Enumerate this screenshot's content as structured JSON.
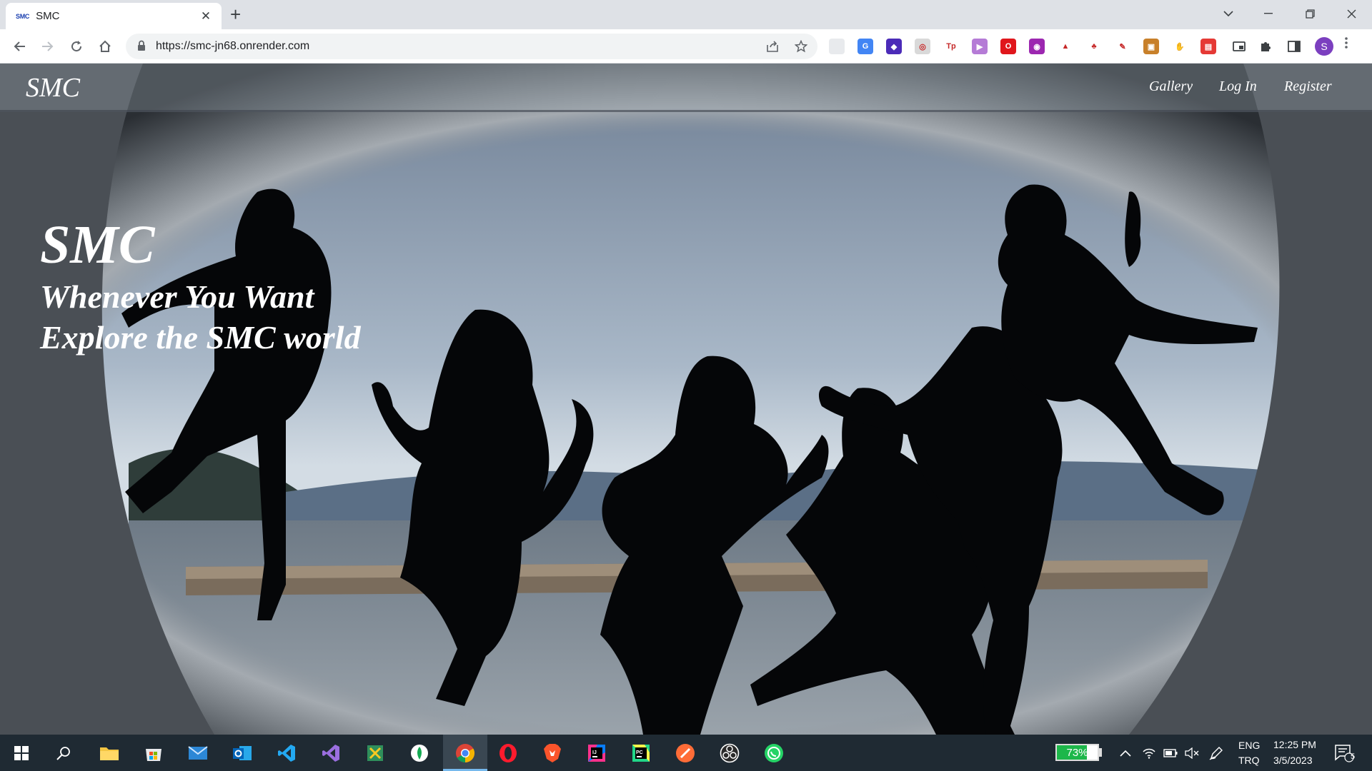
{
  "browser": {
    "tab": {
      "favicon_text": "SMC",
      "title": "SMC",
      "close_glyph": "✕"
    },
    "newtab_glyph": "+",
    "url": "https://smc-jn68.onrender.com",
    "profile_initial": "S",
    "extensions": [
      {
        "icon": "blank-extension-icon",
        "color": "#e8eaed",
        "text": ""
      },
      {
        "icon": "google-translate-icon",
        "color": "#4285f4",
        "text": "G"
      },
      {
        "icon": "badge-extension-icon",
        "color": "#4b2bb8",
        "text": "◆"
      },
      {
        "icon": "circle-extension-icon",
        "color": "#d9d9d9",
        "text": "◎"
      },
      {
        "icon": "tp-extension-icon",
        "color": "#ffffff",
        "text": "Tp"
      },
      {
        "icon": "play-extension-icon",
        "color": "#b57bd6",
        "text": "▶"
      },
      {
        "icon": "opera-extension-icon",
        "color": "#e0161c",
        "text": "O"
      },
      {
        "icon": "purple-extension-icon",
        "color": "#9c27b0",
        "text": "◉"
      },
      {
        "icon": "flame-extension-icon",
        "color": "#ffffff",
        "text": "▲"
      },
      {
        "icon": "clover-extension-icon",
        "color": "#ffffff",
        "text": "♣"
      },
      {
        "icon": "eyedropper-icon",
        "color": "#ffffff",
        "text": "✎"
      },
      {
        "icon": "orange-extension-icon",
        "color": "#c8802a",
        "text": "▣"
      },
      {
        "icon": "hand-extension-icon",
        "color": "#ffffff",
        "text": "✋"
      },
      {
        "icon": "red-box-extension-icon",
        "color": "#e53935",
        "text": "▤"
      }
    ]
  },
  "site": {
    "brand": "SMC",
    "nav": [
      "Gallery",
      "Log In",
      "Register"
    ],
    "hero": {
      "title": "SMC",
      "line1": "Whenever You Want",
      "line2": "Explore the SMC world"
    }
  },
  "taskbar": {
    "battery_percent": "73%",
    "battery_level": 0.73,
    "language_top": "ENG",
    "language_bottom": "TRQ",
    "time": "12:25 PM",
    "date": "3/5/2023",
    "notifications": "5"
  }
}
